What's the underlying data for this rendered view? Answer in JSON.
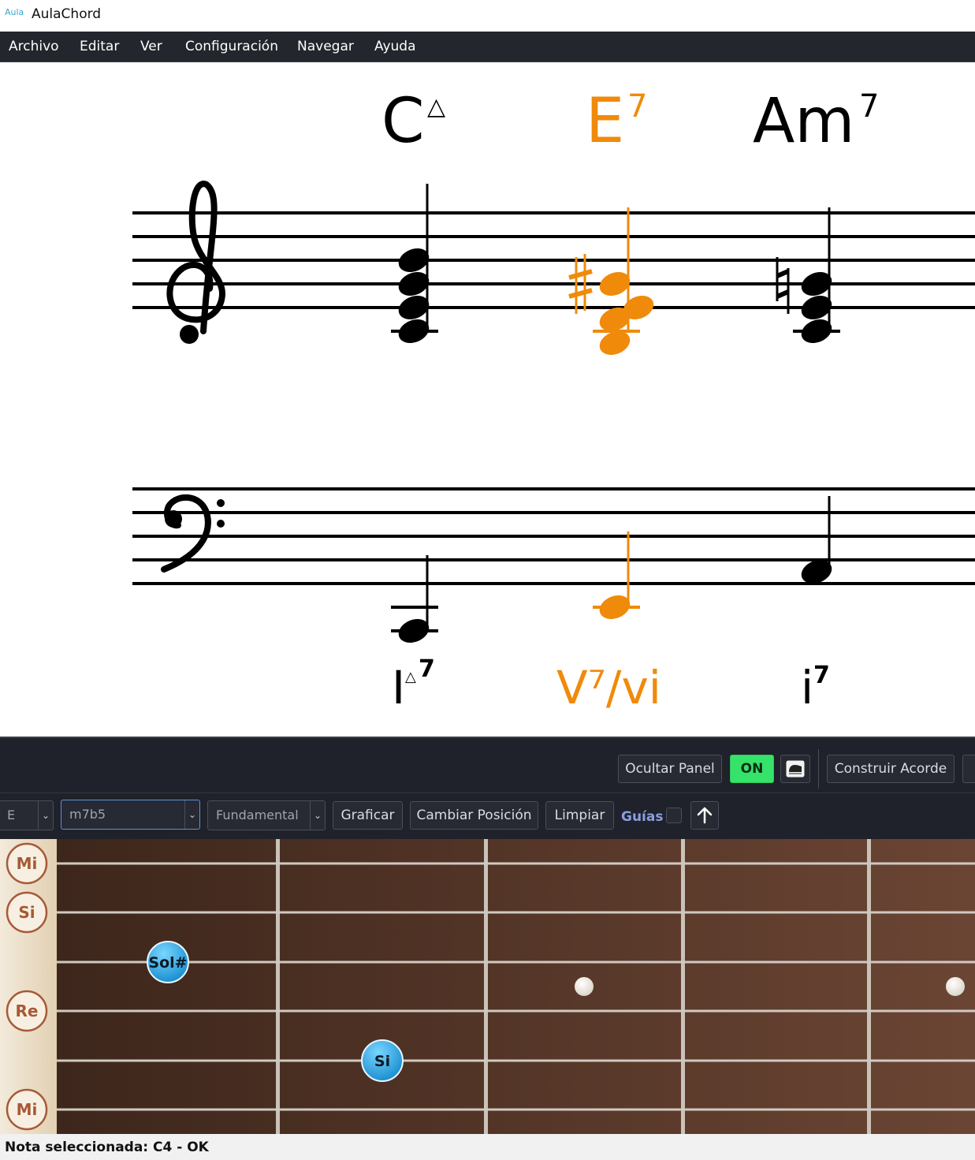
{
  "app": {
    "title": "AulaChord",
    "logo_text": "Aula"
  },
  "menu": {
    "items": [
      "Archivo",
      "Editar",
      "Ver",
      "Configuración",
      "Navegar",
      "Ayuda"
    ]
  },
  "score": {
    "chords": [
      {
        "root": "C",
        "quality": "△",
        "color": "#000000"
      },
      {
        "root": "E",
        "quality": "7",
        "color": "#f08a0a"
      },
      {
        "root": "Am",
        "quality": "7",
        "color": "#000000"
      }
    ],
    "analysis": [
      {
        "base": "I",
        "small": "△",
        "sup": "7",
        "color": "#000000"
      },
      {
        "base": "V⁷/vi",
        "small": "",
        "sup": "",
        "color": "#f08a0a"
      },
      {
        "base": "i",
        "small": "",
        "sup": "7",
        "color": "#000000"
      }
    ],
    "accent_color": "#f08a0a"
  },
  "panel": {
    "hide_panel_label": "Ocultar Panel",
    "on_label": "ON",
    "piano_icon": "piano-icon",
    "build_chord_label": "Construir Acorde"
  },
  "controls": {
    "root_value": "E",
    "quality_value": "m7b5",
    "position_value": "Fundamental",
    "plot_label": "Graficar",
    "change_position_label": "Cambiar Posición",
    "clear_label": "Limpiar",
    "guides_label": "Guías",
    "up_arrow_icon": "arrow-up-icon"
  },
  "fretboard": {
    "string_names": [
      "Mi",
      "Si",
      "",
      "Re",
      "",
      "Mi"
    ],
    "notes": [
      {
        "label": "Sol#",
        "string": 3,
        "fret": 1
      },
      {
        "label": "Si",
        "string": 5,
        "fret": 2
      }
    ],
    "inlay_frets": [
      3,
      5
    ],
    "colors": {
      "wood_dark": "#3d261b",
      "wood_light": "#6b4534",
      "note": "#2a9fd8"
    }
  },
  "status": {
    "text": "Nota seleccionada: C4 - OK"
  }
}
